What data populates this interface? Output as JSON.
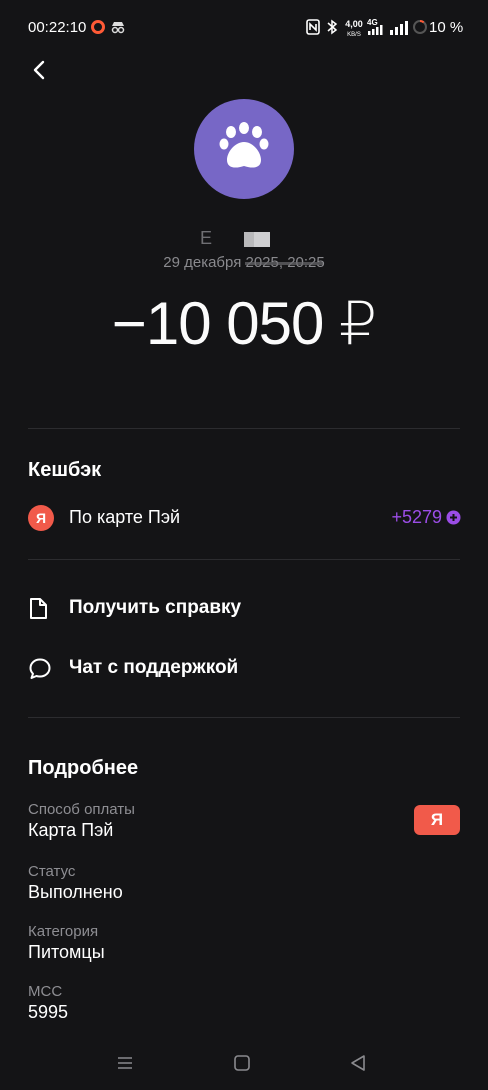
{
  "status_bar": {
    "time": "00:22:10",
    "net_speed_value": "4,00",
    "net_speed_unit": "KB/S",
    "network_type": "4G",
    "battery": "10 %"
  },
  "merchant": {
    "initial": "E",
    "date": "29 декабря 2025, 20:25"
  },
  "amount": "−10 050 ₽",
  "cashback": {
    "title": "Кешбэк",
    "badge": "Я",
    "label": "По карте Пэй",
    "value": "+5279"
  },
  "actions": {
    "certificate": "Получить справку",
    "support_chat": "Чат с поддержкой"
  },
  "details": {
    "title": "Подробнее",
    "payment_method_label": "Способ оплаты",
    "payment_method_value": "Карта Пэй",
    "payment_badge": "Я",
    "status_label": "Статус",
    "status_value": "Выполнено",
    "category_label": "Категория",
    "category_value": "Питомцы",
    "mcc_label": "МСС",
    "mcc_value": "5995"
  },
  "colors": {
    "background": "#141416",
    "avatar": "#7767c6",
    "yandex_red": "#f15a4a",
    "cashback_purple": "#9b4de6"
  },
  "icons": {
    "back": "chevron-left-icon",
    "avatar": "paw-icon",
    "document": "document-icon",
    "chat": "chat-bubble-icon",
    "cashback": "plus-points-icon"
  }
}
